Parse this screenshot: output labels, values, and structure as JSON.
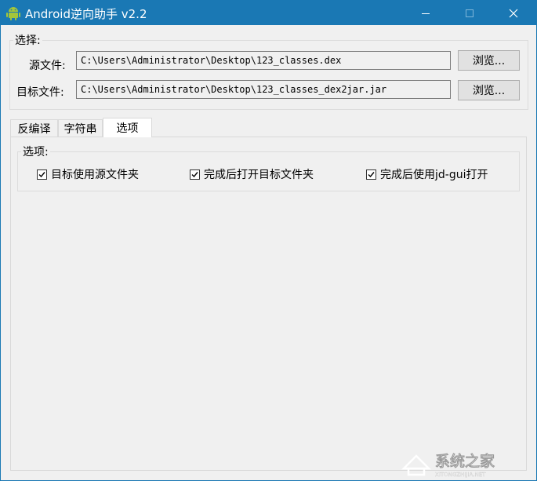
{
  "window": {
    "title": "Android逆向助手 v2.2",
    "controls": [
      "minimize",
      "maximize",
      "close"
    ]
  },
  "select_group": {
    "title": "选择:",
    "source": {
      "label": "源文件:",
      "value": "C:\\Users\\Administrator\\Desktop\\123_classes.dex",
      "button": "浏览..."
    },
    "target": {
      "label": "目标文件:",
      "value": "C:\\Users\\Administrator\\Desktop\\123_classes_dex2jar.jar",
      "button": "浏览..."
    }
  },
  "tabs": [
    {
      "label": "反编译",
      "active": false
    },
    {
      "label": "字符串",
      "active": false
    },
    {
      "label": "选项",
      "active": true
    }
  ],
  "options_group": {
    "title": "选项:",
    "checkboxes": [
      {
        "label": "目标使用源文件夹",
        "checked": true
      },
      {
        "label": "完成后打开目标文件夹",
        "checked": true
      },
      {
        "label": "完成后使用jd-gui打开",
        "checked": true
      }
    ]
  },
  "watermark": {
    "text": "系统之家",
    "subtext": "XITONGZHIJIA.NET"
  },
  "colors": {
    "titlebar": "#1a78b4",
    "face": "#f0f0f0",
    "android_green": "#a4c639"
  }
}
